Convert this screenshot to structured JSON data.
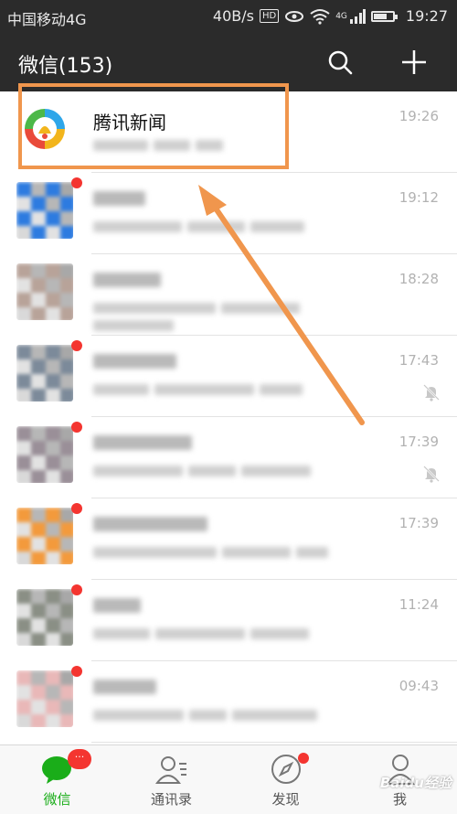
{
  "status_bar": {
    "carrier": "中国移动4G",
    "speed": "40B/s",
    "hd": "HD",
    "net": "4G",
    "time": "19:27",
    "battery_level": 0.7
  },
  "header": {
    "title": "微信(153)",
    "search_icon": "search-icon",
    "add_icon": "plus-icon"
  },
  "chats": [
    {
      "name": "腾讯新闻",
      "time": "19:26",
      "blurred": false,
      "unread_dot": false,
      "muted": false,
      "avatar_color": "#ffffff"
    },
    {
      "time": "19:12",
      "blurred": true,
      "unread_dot": true,
      "muted": false,
      "avatar_color": "#2d7be0"
    },
    {
      "time": "18:28",
      "blurred": true,
      "unread_dot": false,
      "muted": false,
      "avatar_color": "#b8a399"
    },
    {
      "time": "17:43",
      "blurred": true,
      "unread_dot": true,
      "muted": true,
      "avatar_color": "#7c8a9a"
    },
    {
      "time": "17:39",
      "blurred": true,
      "unread_dot": true,
      "muted": true,
      "avatar_color": "#9a8f98"
    },
    {
      "time": "17:39",
      "blurred": true,
      "unread_dot": true,
      "muted": false,
      "avatar_color": "#f39a3c"
    },
    {
      "time": "11:24",
      "blurred": true,
      "unread_dot": true,
      "muted": false,
      "avatar_color": "#8a8f85"
    },
    {
      "time": "09:43",
      "blurred": true,
      "unread_dot": true,
      "muted": false,
      "avatar_color": "#e9b8b8"
    }
  ],
  "tabs": [
    {
      "label": "微信",
      "icon": "chat-bubble-icon",
      "active": true,
      "badge": "···"
    },
    {
      "label": "通讯录",
      "icon": "contacts-icon",
      "active": false
    },
    {
      "label": "发现",
      "icon": "compass-icon",
      "active": false,
      "dot": true
    },
    {
      "label": "我",
      "icon": "person-icon",
      "active": false
    }
  ],
  "watermark": "Baidu经验",
  "colors": {
    "header_bg": "#2b2b2b",
    "accent_green": "#1aad19",
    "badge_red": "#f43530",
    "annotation_orange": "#f0964d"
  }
}
